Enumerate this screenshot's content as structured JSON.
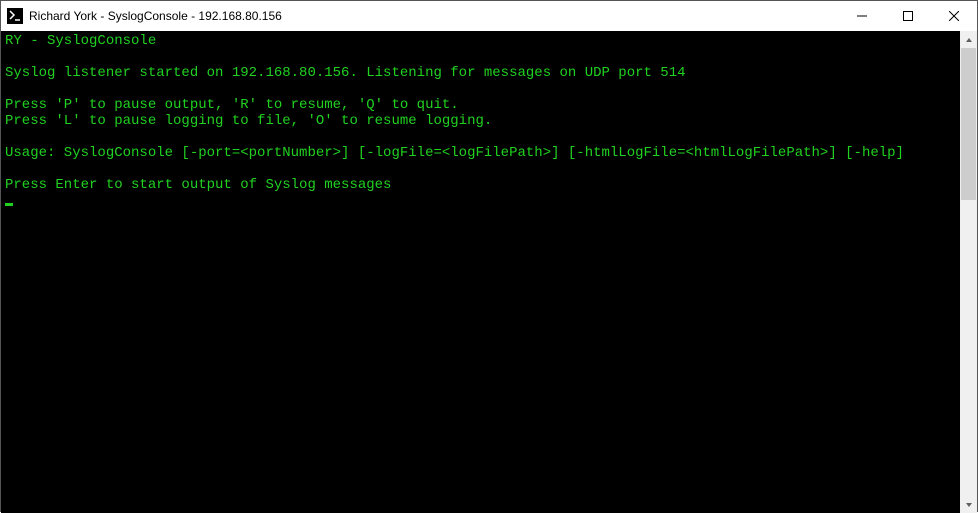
{
  "window": {
    "title": "Richard York - SyslogConsole - 192.168.80.156"
  },
  "console": {
    "lines": [
      "RY - SyslogConsole",
      "",
      "Syslog listener started on 192.168.80.156. Listening for messages on UDP port 514",
      "",
      "Press 'P' to pause output, 'R' to resume, 'Q' to quit.",
      "Press 'L' to pause logging to file, 'O' to resume logging.",
      "",
      "Usage: SyslogConsole [-port=<portNumber>] [-logFile=<logFilePath>] [-htmlLogFile=<htmlLogFilePath>] [-help]",
      "",
      "Press Enter to start output of Syslog messages"
    ]
  }
}
